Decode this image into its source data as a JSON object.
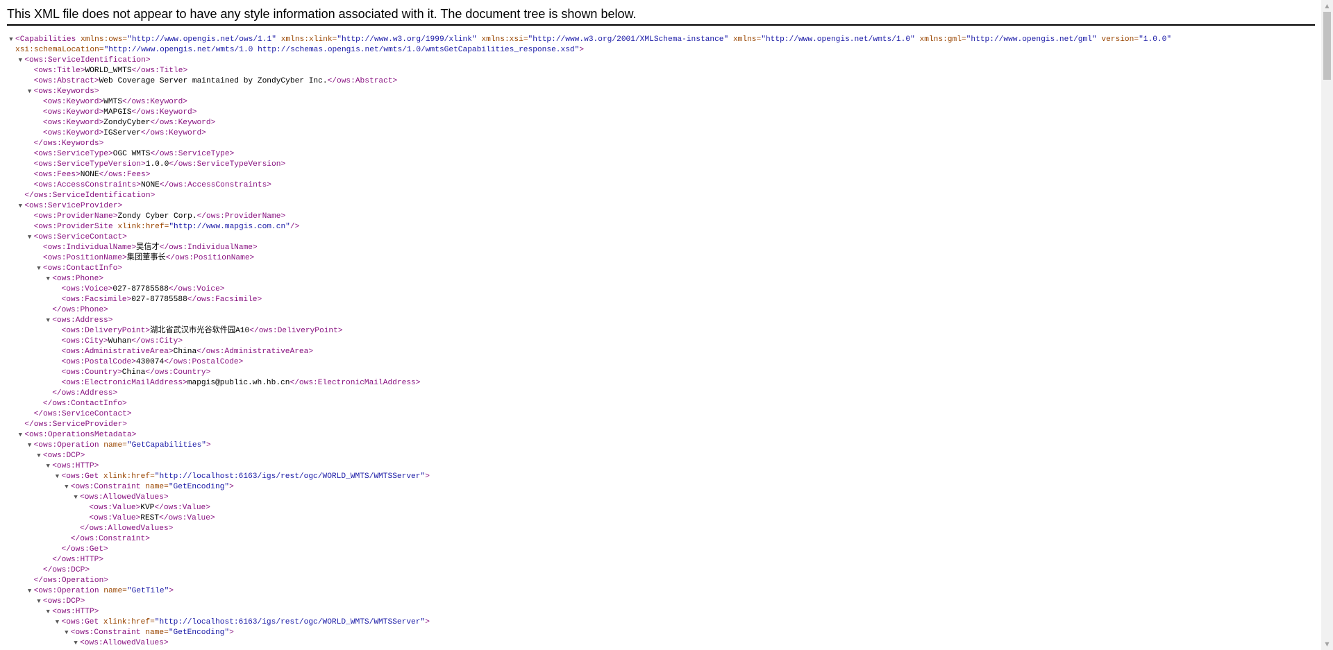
{
  "header": {
    "message": "This XML file does not appear to have any style information associated with it. The document tree is shown below."
  },
  "scrollbar": {
    "up_icon": "scroll-up-arrow",
    "down_icon": "scroll-down-arrow"
  },
  "lines": [
    {
      "i": 0,
      "t": 1,
      "p": [
        [
          "t",
          "<Capabilities"
        ],
        [
          "n",
          " xmlns:ows="
        ],
        [
          "v",
          "\"http://www.opengis.net/ows/1.1\""
        ],
        [
          "n",
          " xmlns:xlink="
        ],
        [
          "v",
          "\"http://www.w3.org/1999/xlink\""
        ],
        [
          "n",
          " xmlns:xsi="
        ],
        [
          "v",
          "\"http://www.w3.org/2001/XMLSchema-instance\""
        ],
        [
          "n",
          " xmlns="
        ],
        [
          "v",
          "\"http://www.opengis.net/wmts/1.0\""
        ],
        [
          "n",
          " xmlns:gml="
        ],
        [
          "v",
          "\"http://www.opengis.net/gml\""
        ],
        [
          "n",
          " version="
        ],
        [
          "v",
          "\"1.0.0\""
        ]
      ]
    },
    {
      "i": 0,
      "t": 0,
      "p": [
        [
          "n",
          "xsi:schemaLocation="
        ],
        [
          "v",
          "\"http://www.opengis.net/wmts/1.0 http://schemas.opengis.net/wmts/1.0/wmtsGetCapabilities_response.xsd\""
        ],
        [
          "t",
          ">"
        ]
      ]
    },
    {
      "i": 1,
      "t": 1,
      "p": [
        [
          "t",
          "<ows:ServiceIdentification>"
        ]
      ]
    },
    {
      "i": 2,
      "t": 0,
      "p": [
        [
          "t",
          "<ows:Title>"
        ],
        [
          "x",
          "WORLD_WMTS"
        ],
        [
          "t",
          "</ows:Title>"
        ]
      ]
    },
    {
      "i": 2,
      "t": 0,
      "p": [
        [
          "t",
          "<ows:Abstract>"
        ],
        [
          "x",
          "Web Coverage Server maintained by ZondyCyber Inc."
        ],
        [
          "t",
          "</ows:Abstract>"
        ]
      ]
    },
    {
      "i": 2,
      "t": 1,
      "p": [
        [
          "t",
          "<ows:Keywords>"
        ]
      ]
    },
    {
      "i": 3,
      "t": 0,
      "p": [
        [
          "t",
          "<ows:Keyword>"
        ],
        [
          "x",
          "WMTS"
        ],
        [
          "t",
          "</ows:Keyword>"
        ]
      ]
    },
    {
      "i": 3,
      "t": 0,
      "p": [
        [
          "t",
          "<ows:Keyword>"
        ],
        [
          "x",
          "MAPGIS"
        ],
        [
          "t",
          "</ows:Keyword>"
        ]
      ]
    },
    {
      "i": 3,
      "t": 0,
      "p": [
        [
          "t",
          "<ows:Keyword>"
        ],
        [
          "x",
          "ZondyCyber"
        ],
        [
          "t",
          "</ows:Keyword>"
        ]
      ]
    },
    {
      "i": 3,
      "t": 0,
      "p": [
        [
          "t",
          "<ows:Keyword>"
        ],
        [
          "x",
          "IGServer"
        ],
        [
          "t",
          "</ows:Keyword>"
        ]
      ]
    },
    {
      "i": 2,
      "t": 0,
      "p": [
        [
          "t",
          "</ows:Keywords>"
        ]
      ]
    },
    {
      "i": 2,
      "t": 0,
      "p": [
        [
          "t",
          "<ows:ServiceType>"
        ],
        [
          "x",
          "OGC WMTS"
        ],
        [
          "t",
          "</ows:ServiceType>"
        ]
      ]
    },
    {
      "i": 2,
      "t": 0,
      "p": [
        [
          "t",
          "<ows:ServiceTypeVersion>"
        ],
        [
          "x",
          "1.0.0"
        ],
        [
          "t",
          "</ows:ServiceTypeVersion>"
        ]
      ]
    },
    {
      "i": 2,
      "t": 0,
      "p": [
        [
          "t",
          "<ows:Fees>"
        ],
        [
          "x",
          "NONE"
        ],
        [
          "t",
          "</ows:Fees>"
        ]
      ]
    },
    {
      "i": 2,
      "t": 0,
      "p": [
        [
          "t",
          "<ows:AccessConstraints>"
        ],
        [
          "x",
          "NONE"
        ],
        [
          "t",
          "</ows:AccessConstraints>"
        ]
      ]
    },
    {
      "i": 1,
      "t": 0,
      "p": [
        [
          "t",
          "</ows:ServiceIdentification>"
        ]
      ]
    },
    {
      "i": 1,
      "t": 1,
      "p": [
        [
          "t",
          "<ows:ServiceProvider>"
        ]
      ]
    },
    {
      "i": 2,
      "t": 0,
      "p": [
        [
          "t",
          "<ows:ProviderName>"
        ],
        [
          "x",
          "Zondy Cyber Corp."
        ],
        [
          "t",
          "</ows:ProviderName>"
        ]
      ]
    },
    {
      "i": 2,
      "t": 0,
      "p": [
        [
          "t",
          "<ows:ProviderSite"
        ],
        [
          "n",
          " xlink:href="
        ],
        [
          "v",
          "\"http://www.mapgis.com.cn\""
        ],
        [
          "t",
          "/>"
        ]
      ]
    },
    {
      "i": 2,
      "t": 1,
      "p": [
        [
          "t",
          "<ows:ServiceContact>"
        ]
      ]
    },
    {
      "i": 3,
      "t": 0,
      "p": [
        [
          "t",
          "<ows:IndividualName>"
        ],
        [
          "x",
          "吴信才"
        ],
        [
          "t",
          "</ows:IndividualName>"
        ]
      ]
    },
    {
      "i": 3,
      "t": 0,
      "p": [
        [
          "t",
          "<ows:PositionName>"
        ],
        [
          "x",
          "集团董事长"
        ],
        [
          "t",
          "</ows:PositionName>"
        ]
      ]
    },
    {
      "i": 3,
      "t": 1,
      "p": [
        [
          "t",
          "<ows:ContactInfo>"
        ]
      ]
    },
    {
      "i": 4,
      "t": 1,
      "p": [
        [
          "t",
          "<ows:Phone>"
        ]
      ]
    },
    {
      "i": 5,
      "t": 0,
      "p": [
        [
          "t",
          "<ows:Voice>"
        ],
        [
          "x",
          "027-87785588"
        ],
        [
          "t",
          "</ows:Voice>"
        ]
      ]
    },
    {
      "i": 5,
      "t": 0,
      "p": [
        [
          "t",
          "<ows:Facsimile>"
        ],
        [
          "x",
          "027-87785588"
        ],
        [
          "t",
          "</ows:Facsimile>"
        ]
      ]
    },
    {
      "i": 4,
      "t": 0,
      "p": [
        [
          "t",
          "</ows:Phone>"
        ]
      ]
    },
    {
      "i": 4,
      "t": 1,
      "p": [
        [
          "t",
          "<ows:Address>"
        ]
      ]
    },
    {
      "i": 5,
      "t": 0,
      "p": [
        [
          "t",
          "<ows:DeliveryPoint>"
        ],
        [
          "x",
          "湖北省武汉市光谷软件园A10"
        ],
        [
          "t",
          "</ows:DeliveryPoint>"
        ]
      ]
    },
    {
      "i": 5,
      "t": 0,
      "p": [
        [
          "t",
          "<ows:City>"
        ],
        [
          "x",
          "Wuhan"
        ],
        [
          "t",
          "</ows:City>"
        ]
      ]
    },
    {
      "i": 5,
      "t": 0,
      "p": [
        [
          "t",
          "<ows:AdministrativeArea>"
        ],
        [
          "x",
          "China"
        ],
        [
          "t",
          "</ows:AdministrativeArea>"
        ]
      ]
    },
    {
      "i": 5,
      "t": 0,
      "p": [
        [
          "t",
          "<ows:PostalCode>"
        ],
        [
          "x",
          "430074"
        ],
        [
          "t",
          "</ows:PostalCode>"
        ]
      ]
    },
    {
      "i": 5,
      "t": 0,
      "p": [
        [
          "t",
          "<ows:Country>"
        ],
        [
          "x",
          "China"
        ],
        [
          "t",
          "</ows:Country>"
        ]
      ]
    },
    {
      "i": 5,
      "t": 0,
      "p": [
        [
          "t",
          "<ows:ElectronicMailAddress>"
        ],
        [
          "x",
          "mapgis@public.wh.hb.cn"
        ],
        [
          "t",
          "</ows:ElectronicMailAddress>"
        ]
      ]
    },
    {
      "i": 4,
      "t": 0,
      "p": [
        [
          "t",
          "</ows:Address>"
        ]
      ]
    },
    {
      "i": 3,
      "t": 0,
      "p": [
        [
          "t",
          "</ows:ContactInfo>"
        ]
      ]
    },
    {
      "i": 2,
      "t": 0,
      "p": [
        [
          "t",
          "</ows:ServiceContact>"
        ]
      ]
    },
    {
      "i": 1,
      "t": 0,
      "p": [
        [
          "t",
          "</ows:ServiceProvider>"
        ]
      ]
    },
    {
      "i": 1,
      "t": 1,
      "p": [
        [
          "t",
          "<ows:OperationsMetadata>"
        ]
      ]
    },
    {
      "i": 2,
      "t": 1,
      "p": [
        [
          "t",
          "<ows:Operation"
        ],
        [
          "n",
          " name="
        ],
        [
          "v",
          "\"GetCapabilities\""
        ],
        [
          "t",
          ">"
        ]
      ]
    },
    {
      "i": 3,
      "t": 1,
      "p": [
        [
          "t",
          "<ows:DCP>"
        ]
      ]
    },
    {
      "i": 4,
      "t": 1,
      "p": [
        [
          "t",
          "<ows:HTTP>"
        ]
      ]
    },
    {
      "i": 5,
      "t": 1,
      "p": [
        [
          "t",
          "<ows:Get"
        ],
        [
          "n",
          " xlink:href="
        ],
        [
          "v",
          "\"http://localhost:6163/igs/rest/ogc/WORLD_WMTS/WMTSServer\""
        ],
        [
          "t",
          ">"
        ]
      ]
    },
    {
      "i": 6,
      "t": 1,
      "p": [
        [
          "t",
          "<ows:Constraint"
        ],
        [
          "n",
          " name="
        ],
        [
          "v",
          "\"GetEncoding\""
        ],
        [
          "t",
          ">"
        ]
      ]
    },
    {
      "i": 7,
      "t": 1,
      "p": [
        [
          "t",
          "<ows:AllowedValues>"
        ]
      ]
    },
    {
      "i": 8,
      "t": 0,
      "p": [
        [
          "t",
          "<ows:Value>"
        ],
        [
          "x",
          "KVP"
        ],
        [
          "t",
          "</ows:Value>"
        ]
      ]
    },
    {
      "i": 8,
      "t": 0,
      "p": [
        [
          "t",
          "<ows:Value>"
        ],
        [
          "x",
          "REST"
        ],
        [
          "t",
          "</ows:Value>"
        ]
      ]
    },
    {
      "i": 7,
      "t": 0,
      "p": [
        [
          "t",
          "</ows:AllowedValues>"
        ]
      ]
    },
    {
      "i": 6,
      "t": 0,
      "p": [
        [
          "t",
          "</ows:Constraint>"
        ]
      ]
    },
    {
      "i": 5,
      "t": 0,
      "p": [
        [
          "t",
          "</ows:Get>"
        ]
      ]
    },
    {
      "i": 4,
      "t": 0,
      "p": [
        [
          "t",
          "</ows:HTTP>"
        ]
      ]
    },
    {
      "i": 3,
      "t": 0,
      "p": [
        [
          "t",
          "</ows:DCP>"
        ]
      ]
    },
    {
      "i": 2,
      "t": 0,
      "p": [
        [
          "t",
          "</ows:Operation>"
        ]
      ]
    },
    {
      "i": 2,
      "t": 1,
      "p": [
        [
          "t",
          "<ows:Operation"
        ],
        [
          "n",
          " name="
        ],
        [
          "v",
          "\"GetTile\""
        ],
        [
          "t",
          ">"
        ]
      ]
    },
    {
      "i": 3,
      "t": 1,
      "p": [
        [
          "t",
          "<ows:DCP>"
        ]
      ]
    },
    {
      "i": 4,
      "t": 1,
      "p": [
        [
          "t",
          "<ows:HTTP>"
        ]
      ]
    },
    {
      "i": 5,
      "t": 1,
      "p": [
        [
          "t",
          "<ows:Get"
        ],
        [
          "n",
          " xlink:href="
        ],
        [
          "v",
          "\"http://localhost:6163/igs/rest/ogc/WORLD_WMTS/WMTSServer\""
        ],
        [
          "t",
          ">"
        ]
      ]
    },
    {
      "i": 6,
      "t": 1,
      "p": [
        [
          "t",
          "<ows:Constraint"
        ],
        [
          "n",
          " name="
        ],
        [
          "v",
          "\"GetEncoding\""
        ],
        [
          "t",
          ">"
        ]
      ]
    },
    {
      "i": 7,
      "t": 1,
      "p": [
        [
          "t",
          "<ows:AllowedValues>"
        ]
      ]
    }
  ]
}
